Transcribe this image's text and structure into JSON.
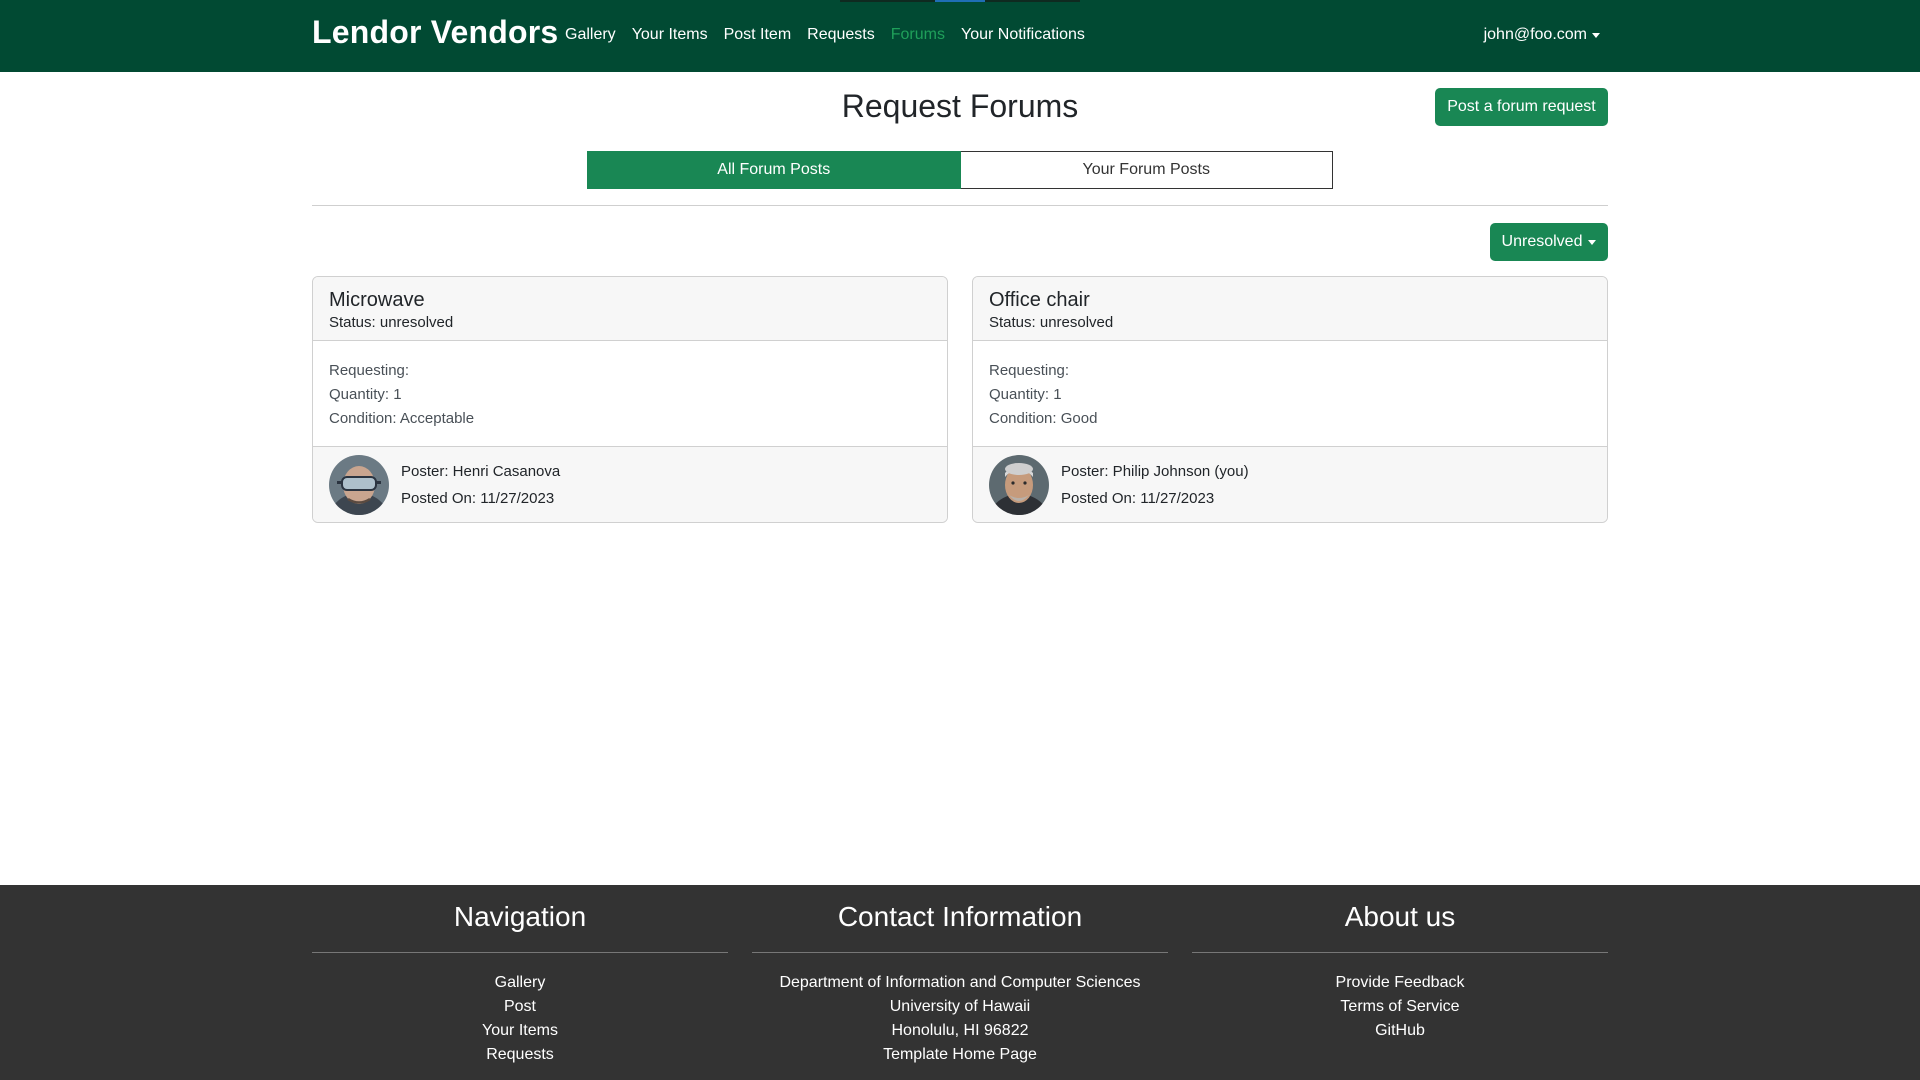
{
  "navbar": {
    "brand": "Lendor Vendors",
    "links": [
      {
        "label": "Gallery"
      },
      {
        "label": "Your Items"
      },
      {
        "label": "Post Item"
      },
      {
        "label": "Requests"
      },
      {
        "label": "Forums",
        "active": true
      },
      {
        "label": "Your Notifications"
      }
    ],
    "user": "john@foo.com"
  },
  "main": {
    "title": "Request Forums",
    "post_button": "Post a forum request",
    "tabs": [
      {
        "label": "All Forum Posts",
        "active": true
      },
      {
        "label": "Your Forum Posts",
        "active": false
      }
    ],
    "filter": "Unresolved"
  },
  "cards": [
    {
      "title": "Microwave",
      "status": "Status: unresolved",
      "requesting": "Requesting:",
      "quantity": "Quantity: 1",
      "condition": "Condition: Acceptable",
      "poster": "Poster: Henri Casanova",
      "posted_on": "Posted On: 11/27/2023"
    },
    {
      "title": "Office chair",
      "status": "Status: unresolved",
      "requesting": "Requesting:",
      "quantity": "Quantity: 1",
      "condition": "Condition: Good",
      "poster": "Poster: Philip Johnson (you)",
      "posted_on": "Posted On: 11/27/2023"
    }
  ],
  "footer": {
    "navigation": {
      "heading": "Navigation",
      "links": [
        "Gallery",
        "Post",
        "Your Items",
        "Requests"
      ]
    },
    "contact": {
      "heading": "Contact Information",
      "lines": [
        "Department of Information and Computer Sciences",
        "University of Hawaii",
        "Honolulu, HI 96822",
        "Template Home Page"
      ]
    },
    "about": {
      "heading": "About us",
      "links": [
        "Provide Feedback",
        "Terms of Service",
        "GitHub"
      ]
    }
  },
  "colors": {
    "navbar_bg": "#014a33",
    "accent_green": "#198754",
    "active_nav": "#1fa05a",
    "footer_bg": "#333333"
  }
}
